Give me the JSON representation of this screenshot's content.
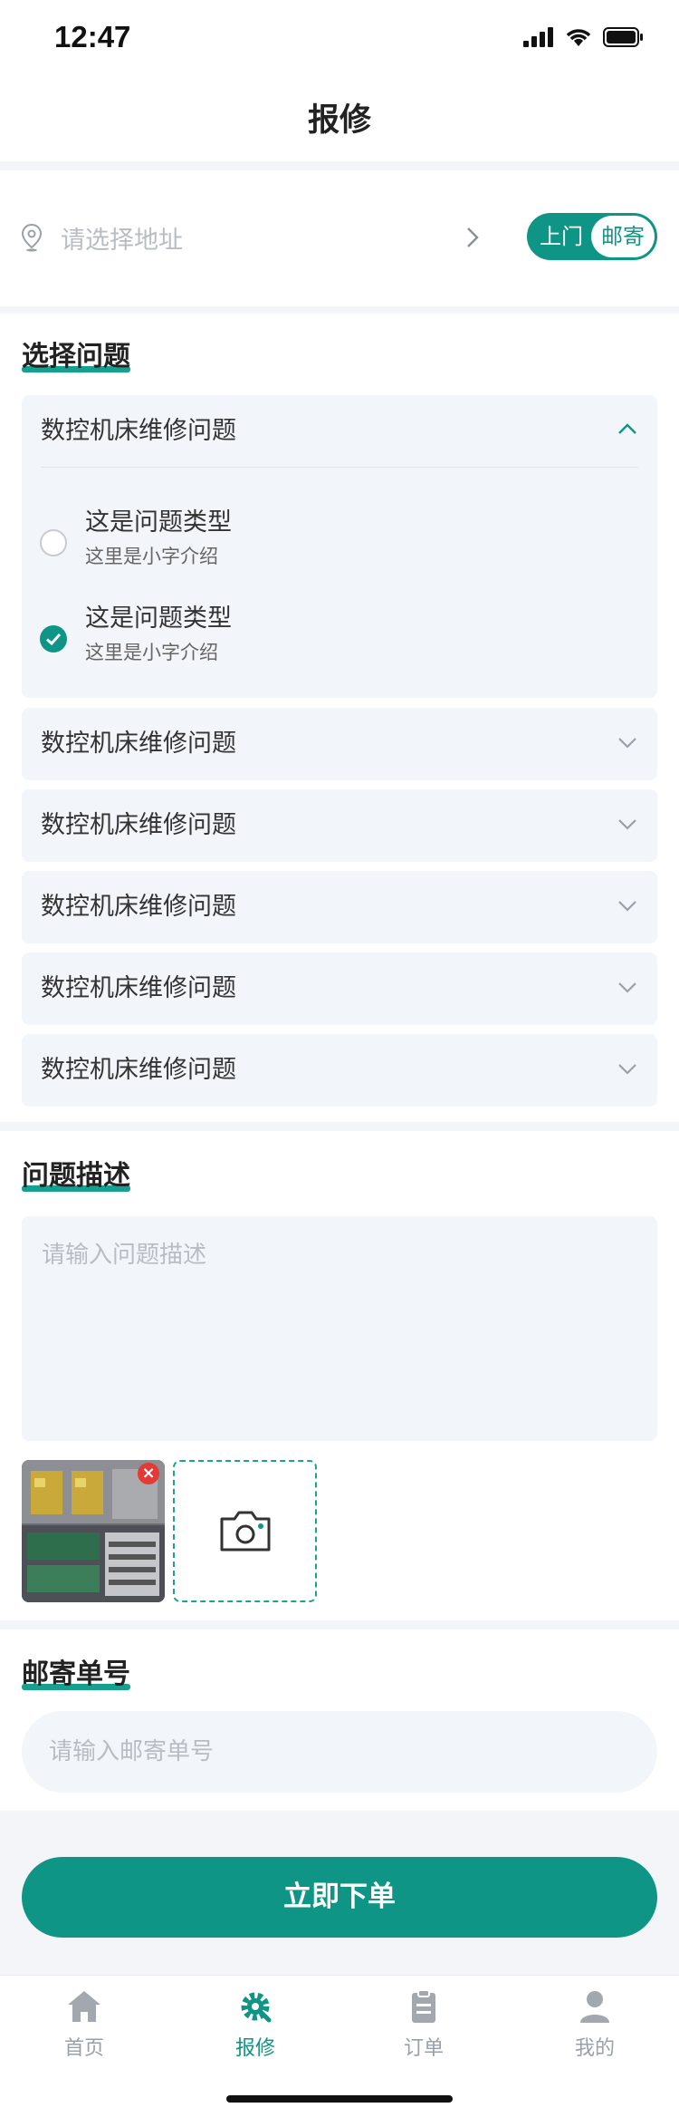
{
  "status_bar": {
    "time": "12:47"
  },
  "nav": {
    "title": "报修"
  },
  "address": {
    "placeholder": "请选择地址",
    "mode_options": [
      "上门",
      "邮寄"
    ],
    "selected_mode": "邮寄"
  },
  "problems": {
    "section_title": "选择问题",
    "expanded": {
      "header": "数控机床维修问题",
      "options": [
        {
          "title": "这是问题类型",
          "subtitle": "这里是小字介绍",
          "checked": false
        },
        {
          "title": "这是问题类型",
          "subtitle": "这里是小字介绍",
          "checked": true
        }
      ]
    },
    "collapsed": [
      "数控机床维修问题",
      "数控机床维修问题",
      "数控机床维修问题",
      "数控机床维修问题",
      "数控机床维修问题"
    ]
  },
  "description": {
    "section_title": "问题描述",
    "placeholder": "请输入问题描述"
  },
  "tracking": {
    "section_title": "邮寄单号",
    "placeholder": "请输入邮寄单号"
  },
  "submit": {
    "label": "立即下单"
  },
  "tabbar": {
    "items": [
      {
        "label": "首页",
        "icon": "home-icon",
        "active": false
      },
      {
        "label": "报修",
        "icon": "gear-wrench-icon",
        "active": true
      },
      {
        "label": "订单",
        "icon": "clipboard-icon",
        "active": false
      },
      {
        "label": "我的",
        "icon": "user-icon",
        "active": false
      }
    ]
  },
  "colors": {
    "accent": "#0f9585",
    "surface": "#f2f5fa",
    "page_bg": "#f3f5f9"
  }
}
